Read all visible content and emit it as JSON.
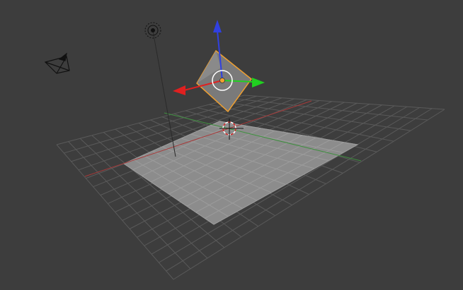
{
  "app": "3D viewport",
  "theme": {
    "background": "#3d3d3d",
    "grid_line": "#5a5a5a",
    "x_axis": "#a83a3a",
    "y_axis": "#3f8f3f",
    "plane_fill": "#8c8c8c",
    "selection_outline": "#f0a030",
    "manip_x": "#e02020",
    "manip_y": "#20d020",
    "manip_z": "#3040e0"
  },
  "objects": {
    "camera": {
      "icon": "camera-icon",
      "selected": false
    },
    "lamp": {
      "icon": "lamp-icon",
      "selected": false
    },
    "cube": {
      "icon": "cube-mesh",
      "selected": true
    },
    "plane": {
      "icon": "plane-mesh",
      "selected": false
    },
    "cursor_3d": {
      "icon": "crosshair-icon"
    }
  },
  "transform_manipulator": {
    "mode": "translate",
    "axes": [
      "x",
      "y",
      "z"
    ]
  }
}
